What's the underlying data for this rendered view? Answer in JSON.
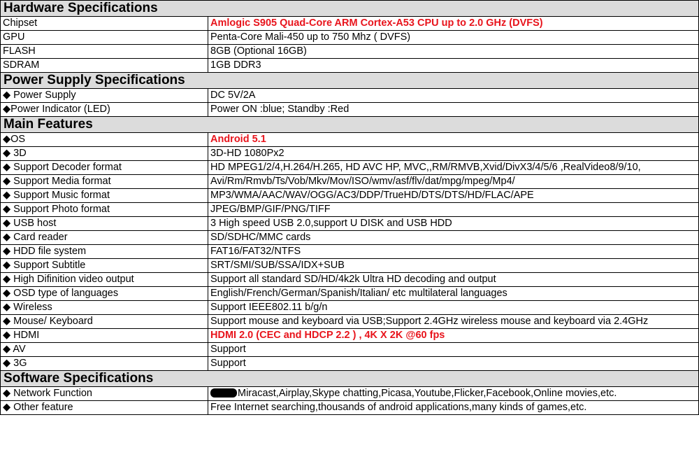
{
  "colors": {
    "header_bg": "#dcdcdc",
    "highlight": "#e8141c",
    "border": "#000000"
  },
  "sections": {
    "hardware": {
      "title": "Hardware Specifications",
      "rows": [
        {
          "label": "Chipset",
          "value": "Amlogic S905  Quad-Core  ARM Cortex-A53 CPU up to 2.0 GHz  (DVFS)",
          "highlight": true
        },
        {
          "label": "GPU",
          "value": "Penta-Core  Mali-450 up to 750 Mhz ( DVFS)"
        },
        {
          "label": "FLASH",
          "value": "8GB  (Optional 16GB)"
        },
        {
          "label": "SDRAM",
          "value": "1GB DDR3"
        }
      ]
    },
    "power": {
      "title": "Power Supply Specifications",
      "rows": [
        {
          "label": "◆ Power Supply",
          "value": "DC 5V/2A"
        },
        {
          "label": "◆Power Indicator (LED)",
          "value": "Power ON :blue; Standby :Red"
        }
      ]
    },
    "main": {
      "title": "Main Features",
      "rows": [
        {
          "label": "◆OS",
          "value": "Android 5.1",
          "highlight": true
        },
        {
          "label": "◆ 3D",
          "value": "3D-HD 1080Px2"
        },
        {
          "label": "◆ Support Decoder format",
          "value": "HD MPEG1/2/4,H.264/H.265, HD AVC HP, MVC,,RM/RMVB,Xvid/DivX3/4/5/6 ,RealVideo8/9/10,"
        },
        {
          "label": "◆ Support Media format",
          "value": "Avi/Rm/Rmvb/Ts/Vob/Mkv/Mov/ISO/wmv/asf/flv/dat/mpg/mpeg/Mp4/"
        },
        {
          "label": "◆ Support Music format",
          "value": "MP3/WMA/AAC/WAV/OGG/AC3/DDP/TrueHD/DTS/DTS/HD/FLAC/APE"
        },
        {
          "label": "◆ Support Photo format",
          "value": "JPEG/BMP/GIF/PNG/TIFF"
        },
        {
          "label": "◆ USB host",
          "value": "3 High speed USB 2.0,support U DISK and USB HDD"
        },
        {
          "label": "◆ Card reader",
          "value": "SD/SDHC/MMC cards"
        },
        {
          "label": "◆ HDD file system",
          "value": "FAT16/FAT32/NTFS"
        },
        {
          "label": "◆ Support Subtitle",
          "value": "SRT/SMI/SUB/SSA/IDX+SUB"
        },
        {
          "label": "◆ High Difinition video output",
          "value": "Support all standard SD/HD/4k2k Ultra HD decoding and output"
        },
        {
          "label": "◆ OSD type of languages",
          "value": "English/French/German/Spanish/Italian/ etc multilateral languages"
        },
        {
          "label": "◆ Wireless",
          "value": "Support IEEE802.11 b/g/n"
        },
        {
          "label": "◆ Mouse/ Keyboard",
          "value": "Support mouse and keyboard via USB;Support 2.4GHz wireless mouse and keyboard via 2.4GHz"
        },
        {
          "label": "◆ HDMI",
          "value": "HDMI 2.0  (CEC and HDCP 2.2 ) , 4K X 2K @60 fps",
          "highlight": true
        },
        {
          "label": "◆ AV",
          "value": "Support"
        },
        {
          "label": "◆ 3G",
          "value": "Support"
        }
      ]
    },
    "software": {
      "title": "Software Specifications",
      "rows": [
        {
          "label": "◆ Network Function",
          "value": "Miracast,Airplay,Skype chatting,Picasa,Youtube,Flicker,Facebook,Online movies,etc.",
          "redacted_prefix": true
        },
        {
          "label": "◆ Other feature",
          "value": "Free Internet searching,thousands of android applications,many kinds of games,etc."
        }
      ]
    }
  }
}
